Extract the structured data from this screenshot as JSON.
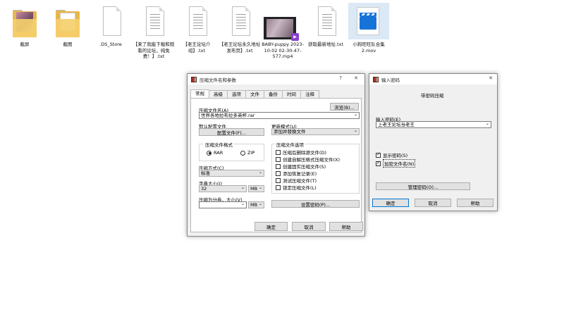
{
  "desktop": {
    "files": [
      {
        "label": "截屏",
        "kind": "folder-photo"
      },
      {
        "label": "截图",
        "kind": "folder-doc"
      },
      {
        "label": ".DS_Store",
        "kind": "file"
      },
      {
        "label": "【来了就能下载和观看的论坛，纯免费！】.txt",
        "kind": "txt"
      },
      {
        "label": "【老王论坛介绍】.txt",
        "kind": "txt"
      },
      {
        "label": "【老王论坛永久地址发布页】.txt",
        "kind": "txt"
      },
      {
        "label": "BABY-puppy 2023-10-02 02-30-47-577.mp4",
        "kind": "video"
      },
      {
        "label": "获取最新地址.txt",
        "kind": "txt"
      },
      {
        "label": "小狗旺旺队合集2.mov",
        "kind": "mov"
      }
    ]
  },
  "archive_dialog": {
    "title": "压缩文件名和参数",
    "help_glyph": "?",
    "close_glyph": "✕",
    "tabs": [
      "常规",
      "高级",
      "选项",
      "文件",
      "备份",
      "时间",
      "注释"
    ],
    "active_tab": "常规",
    "archive_name_label": "压缩文件名(A)",
    "browse_button": "浏览(B)...",
    "archive_name_value": "世界各地拉布拉多英杯.rar",
    "default_profile_label": "默认配置文件",
    "profiles_button": "配置文件(F)...",
    "update_mode_label": "更新模式(U)",
    "update_mode_value": "添加并替换文件",
    "format_group_label": "压缩文件格式",
    "format_rar": "RAR",
    "format_zip": "ZIP",
    "selected_format": "RAR",
    "options_group_label": "压缩文件选项",
    "options": [
      {
        "label": "压缩后删除源文件(D)",
        "checked": false
      },
      {
        "label": "创建自解压格式压缩文件(X)",
        "checked": false
      },
      {
        "label": "创建固实压缩文件(S)",
        "checked": false
      },
      {
        "label": "添加恢复记录(E)",
        "checked": false
      },
      {
        "label": "测试压缩文件(T)",
        "checked": false
      },
      {
        "label": "锁定压缩文件(L)",
        "checked": false
      }
    ],
    "method_label": "压缩方式(C)",
    "method_value": "标准",
    "dict_label": "字典大小(I)",
    "dict_value": "32",
    "dict_unit": "MB",
    "split_label": "压缩为分卷，大小(V)",
    "split_value": "",
    "split_unit": "MB",
    "set_password_button": "设置密码(P)...",
    "ok_button": "确定",
    "cancel_button": "取消",
    "help_button": "帮助"
  },
  "password_dialog": {
    "title": "输入密码",
    "close_glyph": "✕",
    "subtitle": "带密码压缩",
    "enter_password_label": "输入密码(E)",
    "password_value": "上老王论坛当老王",
    "show_password_label": "显示密码(S)",
    "show_password_checked": true,
    "encrypt_names_label": "加密文件名(N)",
    "encrypt_names_checked": true,
    "organize_button": "管理密码(O)...",
    "ok_button": "确定",
    "cancel_button": "取消",
    "help_button": "帮助"
  },
  "colors": {
    "folder": "#e8b649",
    "accent": "#0078d7",
    "mov": "#1773d8"
  }
}
